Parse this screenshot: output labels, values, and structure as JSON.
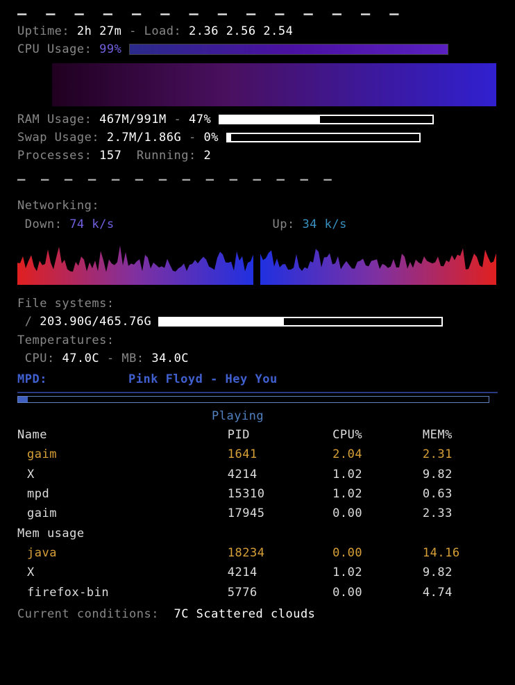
{
  "dashes_top": [
    "—",
    "—",
    "—",
    "—",
    "—",
    "—",
    "—",
    "—",
    "—",
    "—",
    "—",
    "—",
    "—",
    "—"
  ],
  "uptime": {
    "label": "Uptime:",
    "value": "2h 27m",
    "sep": "-",
    "load_label": "Load:",
    "load": "2.36 2.56 2.54"
  },
  "cpu": {
    "label": "CPU Usage:",
    "percent": "99%"
  },
  "ram": {
    "label": "RAM Usage:",
    "value": "467M/991M",
    "sep": "-",
    "percent": "47%",
    "fill": 47
  },
  "swap": {
    "label": "Swap Usage:",
    "value": "2.7M/1.86G",
    "sep": "-",
    "percent": "0%",
    "fill": 2
  },
  "proc": {
    "label": "Processes:",
    "value": "157",
    "run_label": "Running:",
    "run_value": "2"
  },
  "dashes_mid": [
    "—",
    "—",
    "—",
    "—",
    "—",
    "—",
    "—",
    "—",
    "—",
    "—",
    "—",
    "—",
    "—",
    "—"
  ],
  "net": {
    "label": "Networking:",
    "down_label": "Down:",
    "down_value": "74 k/s",
    "up_label": "Up:",
    "up_value": "34 k/s"
  },
  "fs": {
    "label": "File systems:",
    "root_label": "/",
    "root_value": "203.90G/465.76G",
    "fill": 44
  },
  "temp": {
    "label": "Temperatures:",
    "cpu_label": "CPU:",
    "cpu_value": "47.0C",
    "sep": "-",
    "mb_label": "MB:",
    "mb_value": "34.0C"
  },
  "mpd": {
    "label": "MPD:",
    "artist_song": "Pink Floyd - Hey You",
    "progress": 2,
    "status": "Playing"
  },
  "proc_table": {
    "headers": {
      "name": "Name",
      "pid": "PID",
      "cpu": "CPU%",
      "mem": "MEM%"
    },
    "cpu_rows": [
      {
        "name": "gaim",
        "pid": "1641",
        "cpu": "2.04",
        "mem": "2.31",
        "hl": true
      },
      {
        "name": "X",
        "pid": "4214",
        "cpu": "1.02",
        "mem": "9.82",
        "hl": false
      },
      {
        "name": "mpd",
        "pid": "15310",
        "cpu": "1.02",
        "mem": "0.63",
        "hl": false
      },
      {
        "name": "gaim",
        "pid": "17945",
        "cpu": "0.00",
        "mem": "2.33",
        "hl": false
      }
    ],
    "mem_label": "Mem usage",
    "mem_rows": [
      {
        "name": "java",
        "pid": "18234",
        "cpu": "0.00",
        "mem": "14.16",
        "hl": true
      },
      {
        "name": "X",
        "pid": "4214",
        "cpu": "1.02",
        "mem": "9.82",
        "hl": false
      },
      {
        "name": "firefox-bin",
        "pid": "5776",
        "cpu": "0.00",
        "mem": "4.74",
        "hl": false
      }
    ]
  },
  "weather": {
    "label": "Current conditions:",
    "value": "7C Scattered clouds"
  }
}
